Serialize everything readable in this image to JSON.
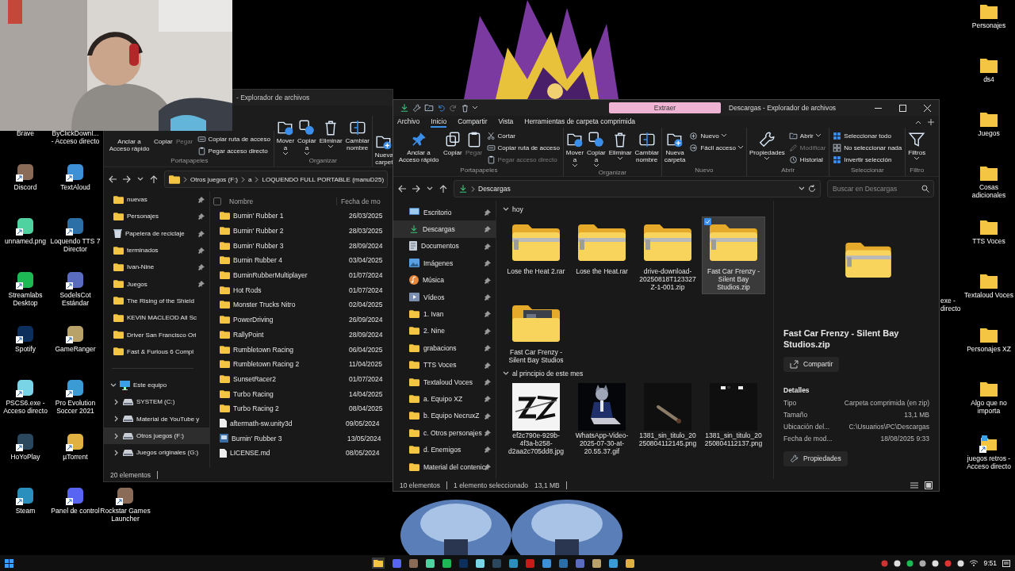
{
  "webcam": {
    "kind": "picture"
  },
  "wallpaper": {
    "kind": "picture"
  },
  "desktop_columns": [
    [
      {
        "label": "Brave",
        "covered": true
      },
      {
        "label": "Discord",
        "covered": false
      },
      {
        "label": "unnamed.png",
        "covered": false
      },
      {
        "label": "Streamlabs Desktop",
        "covered": false
      },
      {
        "label": "Spotify",
        "covered": false
      },
      {
        "label": "PSCS6.exe - Acceso directo",
        "covered": false
      },
      {
        "label": "HoYoPlay",
        "covered": false
      },
      {
        "label": "Steam",
        "covered": false
      }
    ],
    [
      {
        "label": "ByClickDownl... - Acceso directo",
        "covered": true
      },
      {
        "label": "TextAloud",
        "covered": false
      },
      {
        "label": "Loquendo TTS 7 Director",
        "covered": false
      },
      {
        "label": "SodelsCot Estándar",
        "covered": false
      },
      {
        "label": "GameRanger",
        "covered": false
      },
      {
        "label": "Pro Evolution Soccer 2021",
        "covered": false
      },
      {
        "label": "µTorrent",
        "covered": false
      },
      {
        "label": "Panel de control",
        "covered": false
      }
    ],
    [
      {
        "label": "Rockstar Games Launcher",
        "covered": false
      }
    ]
  ],
  "desktop_right": [
    {
      "label": "Personajes",
      "kind": "folder"
    },
    {
      "label": "ds4",
      "kind": "folder"
    },
    {
      "label": "Juegos",
      "kind": "folder"
    },
    {
      "label": "Cosas adicionales",
      "kind": "folder"
    },
    {
      "label": "TTS Voces",
      "kind": "folder"
    },
    {
      "label": "Textaloud Voces",
      "kind": "folder"
    },
    {
      "label": "Personajes XZ",
      "kind": "folder"
    },
    {
      "label": "Algo que no importa",
      "kind": "folder"
    },
    {
      "label": "juegos retros - Acceso directo",
      "kind": "shortcut"
    }
  ],
  "desktop_partial": {
    "label": "exe - directo"
  },
  "back_window": {
    "title": "- Explorador de archivos",
    "ribbon": [
      {
        "label": "Portapapeles",
        "commands": [
          {
            "label": "Anclar a Acceso rápido",
            "kind": "label",
            "disabled": false,
            "dropdown": false
          },
          {
            "label": "Copiar",
            "kind": "label",
            "disabled": false,
            "dropdown": false
          },
          {
            "label": "Pegar",
            "kind": "label",
            "disabled": true,
            "dropdown": false
          },
          {
            "label": "Copiar ruta de acceso",
            "kind": "small",
            "disabled": false,
            "dropdown": false
          },
          {
            "label": "Pegar acceso directo",
            "kind": "small",
            "disabled": false,
            "dropdown": false
          }
        ]
      },
      {
        "label": "Organizar",
        "commands": [
          {
            "label": "Mover a",
            "kind": "large",
            "disabled": false,
            "dropdown": true
          },
          {
            "label": "Copiar a",
            "kind": "large",
            "disabled": false,
            "dropdown": true
          },
          {
            "label": "Eliminar",
            "kind": "large",
            "disabled": false,
            "dropdown": true
          },
          {
            "label": "Cambiar nombre",
            "kind": "large",
            "disabled": false,
            "dropdown": false
          }
        ]
      },
      {
        "commands": [
          {
            "label": "Nueva carpet",
            "kind": "large",
            "disabled": false,
            "dropdown": false
          }
        ]
      }
    ],
    "address": [
      "Otros juegos (F:)",
      "a",
      "LOQUENDO FULL PORTABLE (manuD25)"
    ],
    "nav": [
      {
        "label": "nuevas",
        "kind": "folder",
        "pinned": true,
        "selected": false
      },
      {
        "label": "Personajes",
        "kind": "folder",
        "pinned": true,
        "selected": false
      },
      {
        "label": "Papelera de reciclaje",
        "kind": "recycle",
        "pinned": true,
        "selected": false
      },
      {
        "label": "terminados",
        "kind": "folder",
        "pinned": true,
        "selected": false
      },
      {
        "label": "Ivan-Nine",
        "kind": "folder",
        "pinned": true,
        "selected": false
      },
      {
        "label": "Juegos",
        "kind": "folder",
        "pinned": true,
        "selected": false
      },
      {
        "label": "The Rising of the Shield",
        "kind": "folder",
        "pinned": false,
        "selected": false
      },
      {
        "label": "KEVIN MACLEOD  All Sc",
        "kind": "folder",
        "pinned": false,
        "selected": false
      },
      {
        "label": "Driver San Francisco Ori",
        "kind": "folder",
        "pinned": false,
        "selected": false
      },
      {
        "label": "Fast & Furious 6 Compl",
        "kind": "folder",
        "pinned": false,
        "selected": false
      }
    ],
    "tree": [
      {
        "label": "Este equipo",
        "kind": "pc",
        "expanded": true,
        "selected": false,
        "children": [
          {
            "label": "SYSTEM (C:)",
            "kind": "drive",
            "expanded": false,
            "selected": false
          },
          {
            "label": "Material de YouTube y",
            "kind": "drive",
            "expanded": false,
            "selected": false
          },
          {
            "label": "Otros juegos (F:)",
            "kind": "drive",
            "expanded": false,
            "selected": true
          },
          {
            "label": "Juegos originales (G:)",
            "kind": "drive",
            "expanded": false,
            "selected": false
          }
        ]
      }
    ],
    "select_all": {
      "checked": false
    },
    "columns": [
      "Nombre",
      "Fecha de mo"
    ],
    "rows": [
      {
        "name": "Burnin' Rubber 1",
        "date": "26/03/2025",
        "kind": "folder"
      },
      {
        "name": "Burnin' Rubber 2",
        "date": "28/03/2025",
        "kind": "folder"
      },
      {
        "name": "Burnin' Rubber 3",
        "date": "28/09/2024",
        "kind": "folder"
      },
      {
        "name": "Burnin Rubber 4",
        "date": "03/04/2025",
        "kind": "folder"
      },
      {
        "name": "BurninRubberMultiplayer",
        "date": "01/07/2024",
        "kind": "folder"
      },
      {
        "name": "Hot Rods",
        "date": "01/07/2024",
        "kind": "folder"
      },
      {
        "name": "Monster Trucks Nitro",
        "date": "02/04/2025",
        "kind": "folder"
      },
      {
        "name": "PowerDriving",
        "date": "26/09/2024",
        "kind": "folder"
      },
      {
        "name": "RallyPoint",
        "date": "28/09/2024",
        "kind": "folder"
      },
      {
        "name": "Rumbletown Racing",
        "date": "06/04/2025",
        "kind": "folder"
      },
      {
        "name": "Rumbletown Racing 2",
        "date": "11/04/2025",
        "kind": "folder"
      },
      {
        "name": "SunsetRacer2",
        "date": "01/07/2024",
        "kind": "folder"
      },
      {
        "name": "Turbo Racing",
        "date": "14/04/2025",
        "kind": "folder"
      },
      {
        "name": "Turbo Racing 2",
        "date": "08/04/2025",
        "kind": "folder"
      },
      {
        "name": "aftermath-sw.unity3d",
        "date": "09/05/2024",
        "kind": "file"
      },
      {
        "name": "Burnin' Rubber 3",
        "date": "13/05/2024",
        "kind": "app"
      },
      {
        "name": "LICENSE.md",
        "date": "08/05/2024",
        "kind": "file"
      }
    ],
    "status": "20 elementos"
  },
  "front_window": {
    "title": "Descargas - Explorador de archivos",
    "context_tab": "Extraer",
    "tabs": [
      {
        "label": "Archivo",
        "selected": false
      },
      {
        "label": "Inicio",
        "selected": true
      },
      {
        "label": "Compartir",
        "selected": false
      },
      {
        "label": "Vista",
        "selected": false
      },
      {
        "label": "Herramientas de carpeta comprimida",
        "selected": false
      }
    ],
    "ribbon": [
      {
        "label": "Portapapeles",
        "commands": [
          {
            "label": "Anclar a Acceso rápido",
            "kind": "large",
            "disabled": false,
            "dropdown": false
          },
          {
            "label": "Copiar",
            "kind": "large",
            "disabled": false,
            "dropdown": false
          },
          {
            "label": "Pegar",
            "kind": "large",
            "disabled": true,
            "dropdown": false
          },
          {
            "label": "Cortar",
            "kind": "small",
            "disabled": false,
            "dropdown": false
          },
          {
            "label": "Copiar ruta de acceso",
            "kind": "small",
            "disabled": false,
            "dropdown": false
          },
          {
            "label": "Pegar acceso directo",
            "kind": "small",
            "disabled": true,
            "dropdown": false
          }
        ]
      },
      {
        "label": "Organizar",
        "commands": [
          {
            "label": "Mover a",
            "kind": "large",
            "disabled": false,
            "dropdown": true
          },
          {
            "label": "Copiar a",
            "kind": "large",
            "disabled": false,
            "dropdown": true
          },
          {
            "label": "Eliminar",
            "kind": "large",
            "disabled": false,
            "dropdown": true
          },
          {
            "label": "Cambiar nombre",
            "kind": "large",
            "disabled": false,
            "dropdown": false
          }
        ]
      },
      {
        "label": "Nuevo",
        "commands": [
          {
            "label": "Nueva carpeta",
            "kind": "large",
            "disabled": false,
            "dropdown": false
          },
          {
            "label": "Nuevo",
            "kind": "small",
            "disabled": false,
            "dropdown": true
          },
          {
            "label": "Fácil acceso",
            "kind": "small",
            "disabled": false,
            "dropdown": true
          }
        ]
      },
      {
        "label": "Abrir",
        "commands": [
          {
            "label": "Propiedades",
            "kind": "large",
            "disabled": false,
            "dropdown": true
          },
          {
            "label": "Abrir",
            "kind": "small",
            "disabled": false,
            "dropdown": true
          },
          {
            "label": "Modificar",
            "kind": "small",
            "disabled": true,
            "dropdown": false
          },
          {
            "label": "Historial",
            "kind": "small",
            "disabled": false,
            "dropdown": false
          }
        ]
      },
      {
        "label": "Seleccionar",
        "commands": [
          {
            "label": "Seleccionar todo",
            "kind": "small",
            "disabled": false,
            "dropdown": false
          },
          {
            "label": "No seleccionar nada",
            "kind": "small",
            "disabled": false,
            "dropdown": false
          },
          {
            "label": "Invertir selección",
            "kind": "small",
            "disabled": false,
            "dropdown": false
          }
        ]
      },
      {
        "label": "Filtro",
        "commands": [
          {
            "label": "Filtros",
            "kind": "large",
            "disabled": false,
            "dropdown": true
          }
        ]
      }
    ],
    "address": [
      "Descargas"
    ],
    "search": {
      "placeholder": "Buscar en Descargas"
    },
    "nav": [
      {
        "label": "Escritorio",
        "kind": "desktop",
        "pinned": true,
        "selected": false
      },
      {
        "label": "Descargas",
        "kind": "downloads",
        "pinned": true,
        "selected": true
      },
      {
        "label": "Documentos",
        "kind": "documents",
        "pinned": true,
        "selected": false
      },
      {
        "label": "Imágenes",
        "kind": "pictures",
        "pinned": true,
        "selected": false
      },
      {
        "label": "Música",
        "kind": "music",
        "pinned": true,
        "selected": false
      },
      {
        "label": "Vídeos",
        "kind": "videos",
        "pinned": true,
        "selected": false
      },
      {
        "label": "1. Ivan",
        "kind": "folder",
        "pinned": true,
        "selected": false
      },
      {
        "label": "2. Nine",
        "kind": "folder",
        "pinned": true,
        "selected": false
      },
      {
        "label": "grabacions",
        "kind": "folder",
        "pinned": true,
        "selected": false
      },
      {
        "label": "TTS Voces",
        "kind": "folder",
        "pinned": true,
        "selected": false
      },
      {
        "label": "Textaloud Voces",
        "kind": "folder",
        "pinned": true,
        "selected": false
      },
      {
        "label": "a. Equipo XZ",
        "kind": "folder",
        "pinned": true,
        "selected": false
      },
      {
        "label": "b. Equipo NecruxZ",
        "kind": "folder",
        "pinned": true,
        "selected": false
      },
      {
        "label": "c. Otros personajes",
        "kind": "folder",
        "pinned": true,
        "selected": false
      },
      {
        "label": "d. Enemigos",
        "kind": "folder",
        "pinned": true,
        "selected": false
      },
      {
        "label": "Material del contenic",
        "kind": "folder",
        "pinned": true,
        "selected": false
      }
    ],
    "groups": [
      {
        "label": "hoy",
        "expanded": true,
        "items": [
          {
            "name": "Lose the Heat 2.rar",
            "kind": "archive",
            "selected": false
          },
          {
            "name": "Lose the Heat.rar",
            "kind": "archive",
            "selected": false
          },
          {
            "name": "drive-download-20250818T123327Z-1-001.zip",
            "kind": "archive",
            "selected": false
          },
          {
            "name": "Fast Car Frenzy - Silent Bay Studios.zip",
            "kind": "archive",
            "selected": true
          },
          {
            "name": "Fast Car Frenzy - Silent Bay Studios",
            "kind": "folder",
            "selected": false
          }
        ]
      },
      {
        "label": "al principio de este mes",
        "expanded": true,
        "items": [
          {
            "name": "ef2c790e-929b-4f3a-b258-d2aa2c705dd8.jpg",
            "kind": "picture",
            "selected": false
          },
          {
            "name": "WhatsApp-Video-2025-07-30-at-20.55.37.gif",
            "kind": "picture",
            "selected": false
          },
          {
            "name": "1381_sin_titulo_20250804112145.png",
            "kind": "picture",
            "selected": false
          },
          {
            "name": "1381_sin_titulo_20250804112137.png",
            "kind": "picture",
            "selected": false
          }
        ]
      }
    ],
    "details": {
      "title": "Fast Car Frenzy - Silent Bay Studios.zip",
      "share": "Compartir",
      "heading": "Detalles",
      "rows": [
        {
          "label": "Tipo",
          "value": "Carpeta comprimida (en zip)"
        },
        {
          "label": "Tamaño",
          "value": "13,1 MB"
        },
        {
          "label": "Ubicación del...",
          "value": "C:\\Usuarios\\PC\\Descargas"
        },
        {
          "label": "Fecha de mod...",
          "value": "18/08/2025 9:33"
        }
      ],
      "properties": "Propiedades"
    },
    "status": [
      "10 elementos",
      "1 elemento seleccionado",
      "13,1 MB"
    ]
  },
  "taskbar": {
    "time": "9:51"
  }
}
